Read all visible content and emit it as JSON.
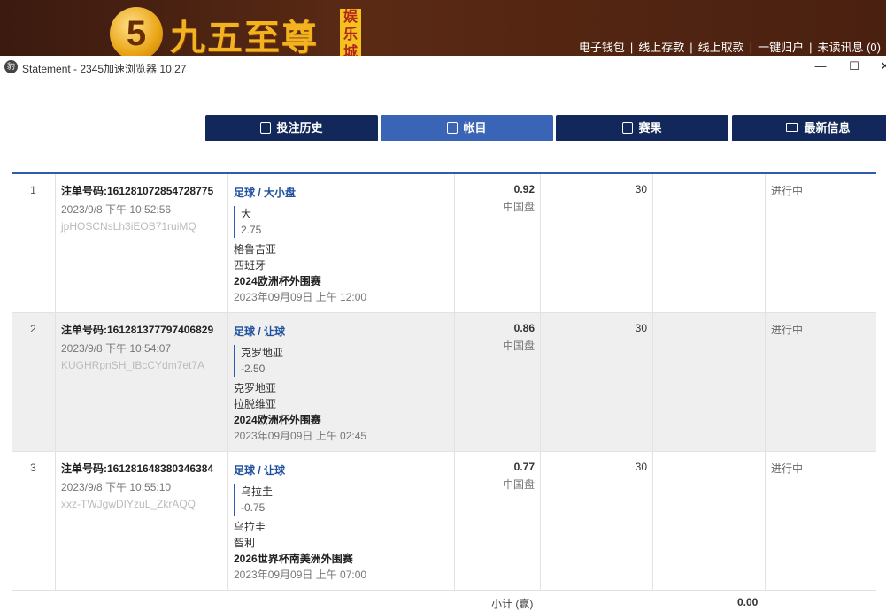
{
  "site": {
    "logo_digit": "5",
    "logo_name": "九五至尊",
    "logo_badge": "娱乐城",
    "links": [
      "电子钱包",
      "线上存款",
      "线上取款",
      "一键归户",
      "未读讯息 (0)"
    ]
  },
  "browser": {
    "title": "Statement - 2345加速浏览器 10.27",
    "icon_glyph": "豹",
    "minimize": "—",
    "maximize": "☐",
    "close": "✕"
  },
  "tabs": [
    {
      "label": "投注历史",
      "icon": "document-icon"
    },
    {
      "label": "帐目",
      "icon": "ledger-icon"
    },
    {
      "label": "赛果",
      "icon": "trophy-icon"
    },
    {
      "label": "最新信息",
      "icon": "mail-icon"
    }
  ],
  "rows": [
    {
      "num": "1",
      "ticket": "注单号码:161281072854728775",
      "time": "2023/9/8 下午 10:52:56",
      "code": "jpHOSCNsLh3iEOB71ruiMQ",
      "sport": "足球 / 大小盘",
      "pick": "大",
      "handicap": "2.75",
      "home": "格鲁吉亚",
      "away": "西班牙",
      "league": "2024欧洲杯外围赛",
      "match_time": "2023年09月09日 上午 12:00",
      "odds": "0.92",
      "odds_type": "中国盘",
      "stake": "30",
      "status": "进行中"
    },
    {
      "num": "2",
      "ticket": "注单号码:161281377797406829",
      "time": "2023/9/8 下午 10:54:07",
      "code": "KUGHRpnSH_IBcCYdm7et7A",
      "sport": "足球 / 让球",
      "pick": "克罗地亚",
      "handicap": "-2.50",
      "home": "克罗地亚",
      "away": "拉脱维亚",
      "league": "2024欧洲杯外围赛",
      "match_time": "2023年09月09日 上午 02:45",
      "odds": "0.86",
      "odds_type": "中国盘",
      "stake": "30",
      "status": "进行中"
    },
    {
      "num": "3",
      "ticket": "注单号码:161281648380346384",
      "time": "2023/9/8 下午 10:55:10",
      "code": "xxz-TWJgwDIYzuL_ZkrAQQ",
      "sport": "足球 / 让球",
      "pick": "乌拉圭",
      "handicap": "-0.75",
      "home": "乌拉圭",
      "away": "智利",
      "league": "2026世界杯南美洲外围赛",
      "match_time": "2023年09月09日 上午 07:00",
      "odds": "0.77",
      "odds_type": "中国盘",
      "stake": "30",
      "status": "进行中"
    }
  ],
  "subtotal": {
    "label": "小计 (赢)",
    "value": "0.00"
  }
}
